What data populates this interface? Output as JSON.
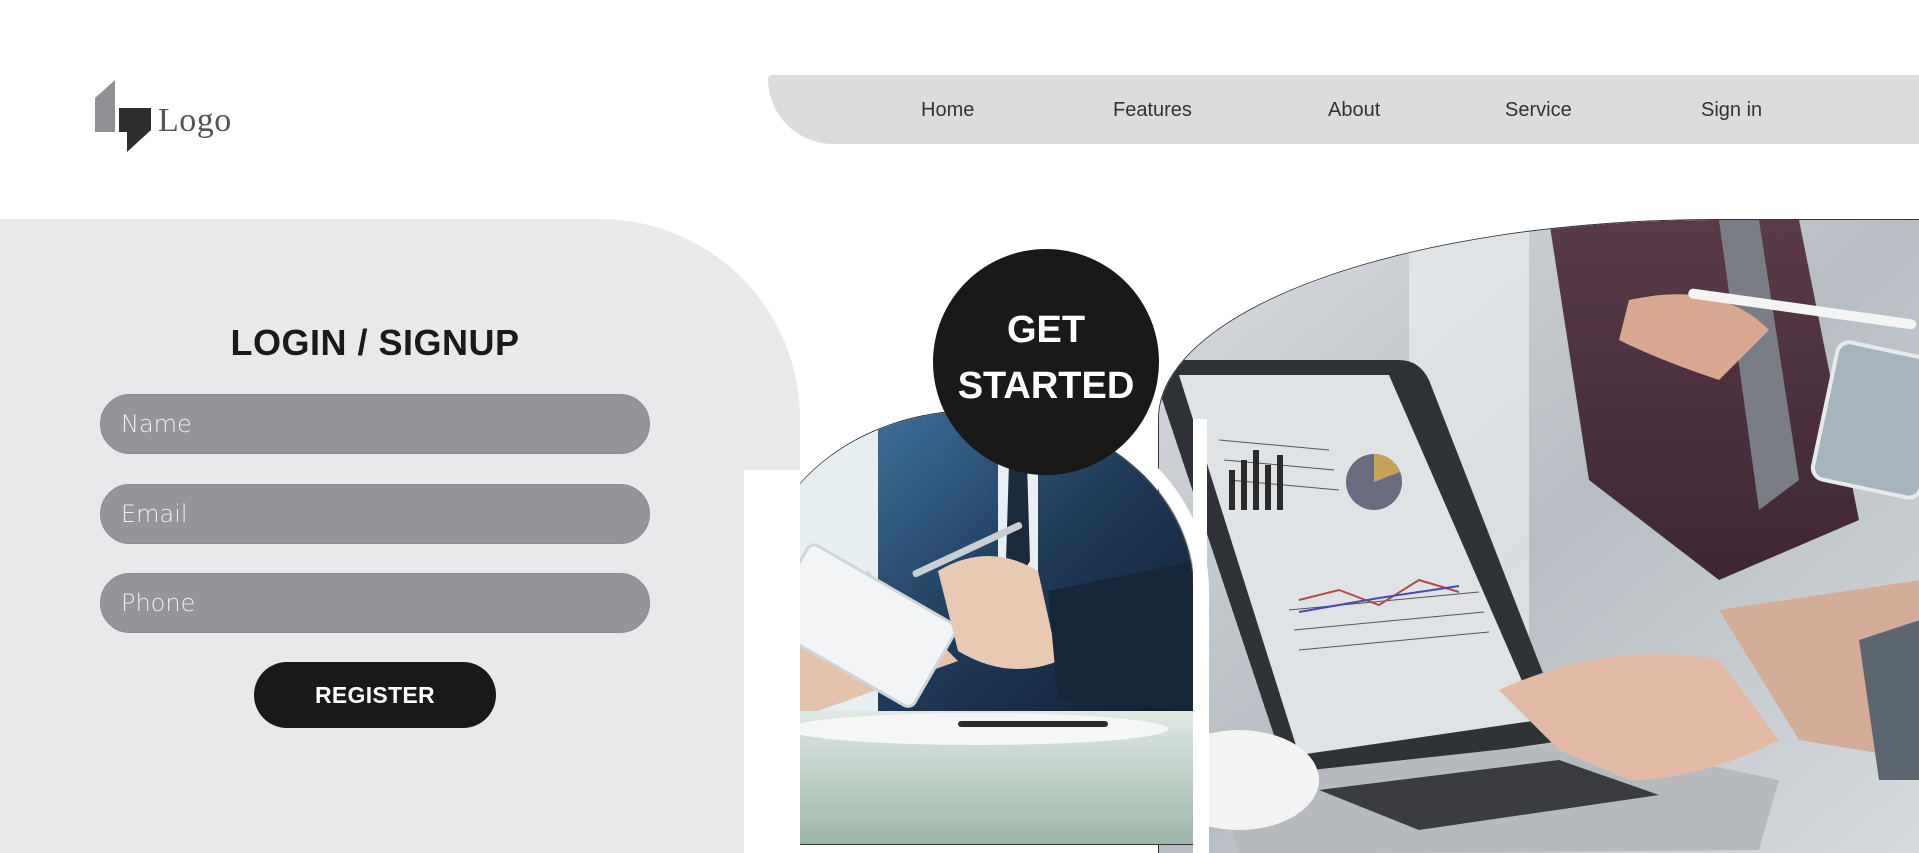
{
  "header": {
    "logo_text": "Logo",
    "nav": [
      "Home",
      "Features",
      "About",
      "Service",
      "Sign in"
    ]
  },
  "form": {
    "title": "LOGIN / SIGNUP",
    "fields": [
      {
        "placeholder": "Name",
        "value": ""
      },
      {
        "placeholder": "Email",
        "value": ""
      },
      {
        "placeholder": "Phone",
        "value": ""
      }
    ],
    "register_label": "REGISTER"
  },
  "cta": {
    "line1": "GET",
    "line2": "STARTED"
  },
  "colors": {
    "nav_bg": "#dcdcdc",
    "panel_bg": "#e8e9eb",
    "field_bg": "#939598",
    "dark": "#1a1918"
  },
  "icons": {
    "logo": "logo-mark-icon"
  }
}
